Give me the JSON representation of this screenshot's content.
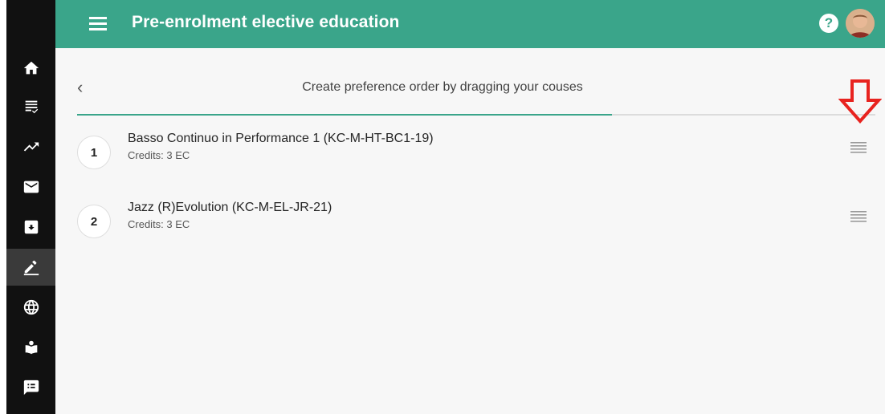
{
  "app": {
    "title": "Pre-enrolment elective education",
    "help_label": "?"
  },
  "sidebar": {
    "items": [
      {
        "icon": "home-icon"
      },
      {
        "icon": "list-check-icon"
      },
      {
        "icon": "trending-up-icon"
      },
      {
        "icon": "mail-icon"
      },
      {
        "icon": "inbox-icon"
      },
      {
        "icon": "edit-icon",
        "active": true
      },
      {
        "icon": "globe-icon"
      },
      {
        "icon": "person-book-icon"
      },
      {
        "icon": "feedback-icon"
      }
    ]
  },
  "page": {
    "back_label": "‹",
    "heading": "Create preference order by dragging your couses",
    "progress": 0.67
  },
  "courses": [
    {
      "rank": "1",
      "title": "Basso Continuo in Performance 1 (KC-M-HT-BC1-19)",
      "credits": "Credits: 3 EC"
    },
    {
      "rank": "2",
      "title": "Jazz (R)Evolution (KC-M-EL-JR-21)",
      "credits": "Credits: 3 EC"
    }
  ],
  "colors": {
    "accent": "#3aa58a",
    "sidebar": "#111111",
    "annotation": "#e8231f"
  }
}
